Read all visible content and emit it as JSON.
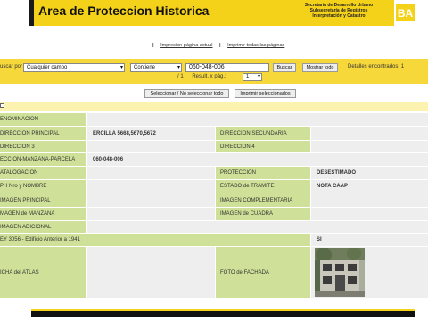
{
  "banner": {
    "title": "Area de Proteccion Historica",
    "sub1": "Secretaría de Desarrollo Urbano",
    "sub2": "Subsecretaría de Registros",
    "sub3": "Interpretación y Catastro",
    "logo_text": "BA",
    "accent": "#f5d21a"
  },
  "links": {
    "print_page": "Impresion página actual",
    "print_all": "Imprimir todas las páginas"
  },
  "search": {
    "label": "uscar por",
    "field": "Cualquier campo",
    "operator": "Contiene",
    "value": "060-048-006",
    "search_btn": "Buscar",
    "show_all_btn": "Mostrar todo",
    "found_label": "Detalles encontrados: 1",
    "page_of": "/ 1",
    "result_label": "Result. x pág.:",
    "per_page": "1"
  },
  "actions": {
    "toggle_select": "Seleccionar / No seleccionar todo",
    "print_selected": "Imprimir seleccionados"
  },
  "record": {
    "denominacion_label": "ENOMINACION",
    "direccion_principal_label": "DIRECCION PRINCIPAL",
    "direccion_principal_value": "ERCILLA 5668,5670,5672",
    "direccion_secundaria_label": "DIRECCION SECUNDARIA",
    "direccion3_label": "DIRECCION 3",
    "direccion4_label": "DIRECCION 4",
    "smp_label": "ECCION-MANZANA-PARCELA",
    "smp_value": "060-048-006",
    "catalogacion_label": "ATALOGACION",
    "proteccion_label": "PROTECCION",
    "proteccion_value": "DESESTIMADO",
    "aph_label": "PH Nro y NOMBRE",
    "estado_label": "ESTADO de TRAMITE",
    "estado_value": "NOTA CAAP",
    "img_principal_label": "IMAGEN PRINCIPAL",
    "img_complementaria_label": "IMAGEN COMPLEMENTARIA",
    "img_manzana_label": "MAGEN de MANZANA",
    "img_cuadra_label": "IMAGEN de CUADRA",
    "img_adicional_label": "IMAGEN ADICIONAL",
    "ley_label": "EY 3056 - Edificio Anterior a 1941",
    "ley_value": "SI",
    "atlas_label": "ICHA del ATLAS",
    "foto_label": "FOTO de FACHADA"
  }
}
